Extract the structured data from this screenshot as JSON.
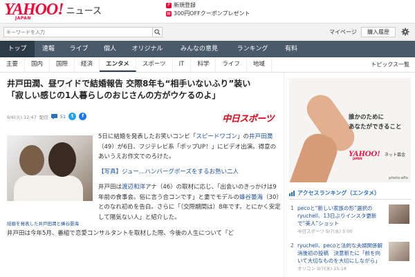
{
  "header": {
    "logo": "YAHOO!",
    "logo_sub": "JAPAN",
    "logo_section": "ニュース",
    "promo_signup": "新規登録",
    "promo_coupon": "300円OFFクーポンプレゼント"
  },
  "search": {
    "placeholder": "キーワードを入力",
    "mypage": "マイページ",
    "member_button": "購入履歴"
  },
  "nav": {
    "items": [
      "トップ",
      "速報",
      "ライブ",
      "個人",
      "オリジナル",
      "みんなの意見",
      "ランキング",
      "有料"
    ]
  },
  "subnav": {
    "items": [
      "主要",
      "国内",
      "国際",
      "経済",
      "エンタメ",
      "スポーツ",
      "IT",
      "科学",
      "ライフ",
      "地域"
    ],
    "right_link": "トピックス一覧"
  },
  "article": {
    "title_line1": "井戸田潤、昼ワイドで結婚報告 交際8年も“相手いないふり”装い",
    "title_line2": "「寂しい感じの1人暮らしのおじさんの方がウケるのよ」",
    "date": "9/6(火) 12:47",
    "meta_label": "配信",
    "comment_count": "51",
    "source": "中日スポーツ",
    "photo_caption": "結婚を発表した井戸田潤と蜂谷晏海",
    "p1_pre": "5日に結婚を発表したお笑いコンビ「",
    "p1_link1": "スピードワゴン",
    "p1_mid1": "」の",
    "p1_link2": "井戸田潤",
    "p1_post": "（49）が6日、フジテレビ系「ポップUP！」にビデオ出演。得意のあいうえお作文でのろけた。",
    "p2_link": "【写真】ジュー…ハンバーグポーズをするお熱い二人",
    "p3_pre": "井戸田は",
    "p3_link1": "渡辺和洋",
    "p3_mid1": "アナ（46）の取材に応じ、「出会いのきっかけは9年前の食事会。俗に言う合コンです」と妻でモデルの",
    "p3_link2": "蜂谷晏海",
    "p3_post": "（30）とのなれ初めを告白。さらに「（交際期間は）8年です。とにかく安定して陽気ない人」と紹介した。",
    "p4": "井戸田は今年5月、番組で恋愛コンサルタントを取材した際、今後の人生について「ど"
  },
  "ad": {
    "line1": "誰かのために",
    "line2": "あなたができること",
    "logo": "YAHOO!",
    "logo_sub": "JAPAN",
    "logo_tag": "ネット募金",
    "credit": "photo:aflo"
  },
  "ranking": {
    "title": "アクセスランキング（エンタメ）",
    "items": [
      {
        "num": "1",
        "text": "pecoと“新しい家族の形”選択のryuchell、13日ぶりインスタ更新で“美人”ショット",
        "time": ""
      },
      {
        "num": "2",
        "text": "ryuchell、pecoと法的な夫婦関係解消後初の投稿　決意新たに「前を向いて大切なものを大切にしながら」",
        "time": "オリコン 9/7(水) 15:18"
      }
    ],
    "first_time": "中日スポーツ 9/7(水) 5:00"
  },
  "colors": {
    "brand_red": "#ff0033",
    "nav_bg": "#4a5a6b",
    "nav_active": "#2d3a47",
    "link": "#1a4fa0"
  }
}
